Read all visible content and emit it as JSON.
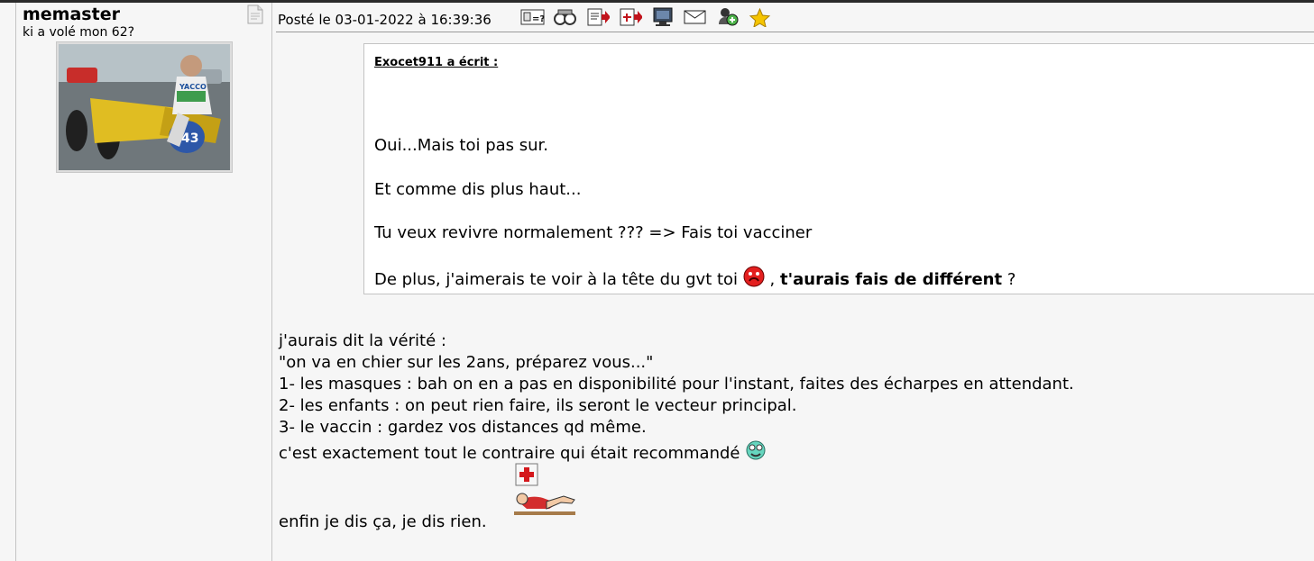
{
  "author": {
    "name": "memaster",
    "status": "ki a volé mon 62?"
  },
  "post": {
    "posted": "Posté le 03-01-2022 à 16:39:36",
    "actions": [
      "profile-card-icon",
      "binoculars-icon",
      "quote-icon",
      "multi-quote-icon",
      "screen-icon",
      "mail-icon",
      "alert-icon",
      "star-icon"
    ]
  },
  "quote": {
    "author": "Exocet911 a écrit :",
    "line1": "Oui...Mais toi pas sur.",
    "line2": "Et comme dis plus haut...",
    "line3": "Tu veux revivre normalement ??? => Fais toi vacciner",
    "line4_start": "De plus, j'aimerais te voir à la tête du gvt toi",
    "line4_comma": ",",
    "line4_bold": "t'aurais fais de différent",
    "line4_end": "?"
  },
  "reply": {
    "line1": "j'aurais dit la vérité :",
    "line2": "\"on va en chier sur les 2ans, préparez vous...\"",
    "line3": "1- les masques : bah on en a pas en disponibilité pour l'instant, faites des écharpes en attendant.",
    "line4": "2- les enfants : on peut rien faire, ils seront le vecteur principal.",
    "line5": "3- le vaccin : gardez vos distances qd même.",
    "line6": "c'est exactement tout le contraire qui était recommandé",
    "line8": "enfin je dis ça, je dis rien."
  }
}
